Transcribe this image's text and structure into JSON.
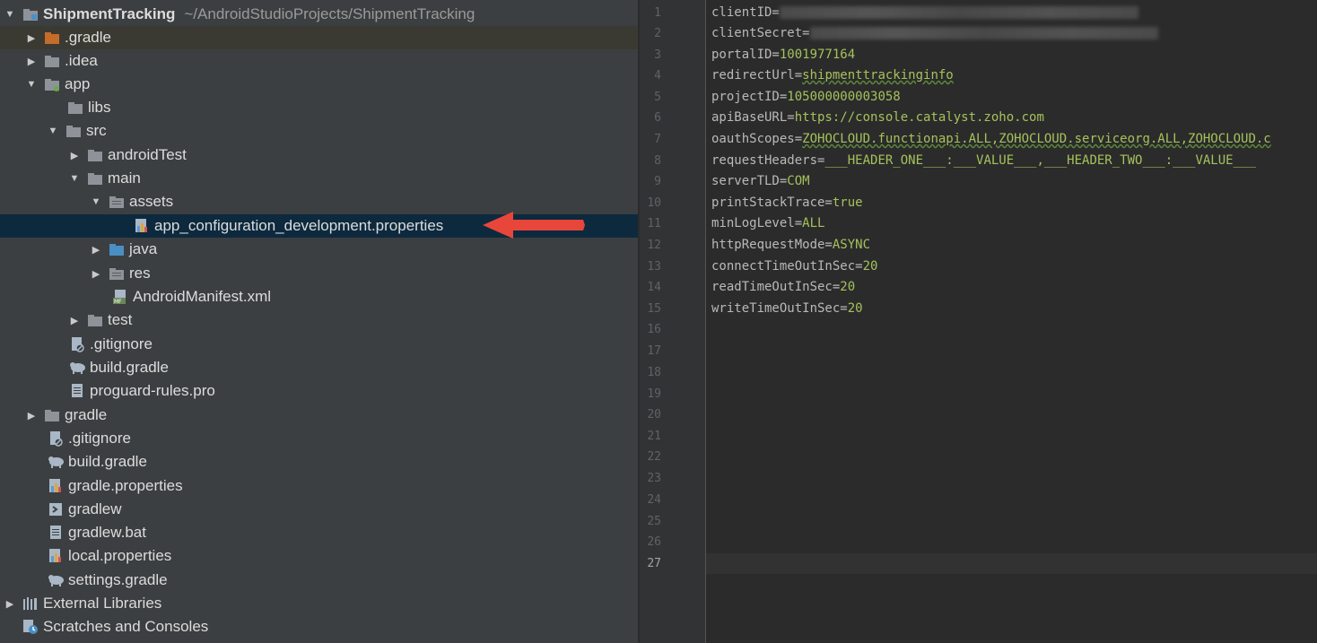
{
  "tree": {
    "project_name": "ShipmentTracking",
    "project_path": "~/AndroidStudioProjects/ShipmentTracking",
    "items": [
      {
        "label": ".gradle"
      },
      {
        "label": ".idea"
      },
      {
        "label": "app"
      },
      {
        "label": "libs"
      },
      {
        "label": "src"
      },
      {
        "label": "androidTest"
      },
      {
        "label": "main"
      },
      {
        "label": "assets"
      },
      {
        "label": "app_configuration_development.properties"
      },
      {
        "label": "java"
      },
      {
        "label": "res"
      },
      {
        "label": "AndroidManifest.xml"
      },
      {
        "label": "test"
      },
      {
        "label": ".gitignore"
      },
      {
        "label": "build.gradle"
      },
      {
        "label": "proguard-rules.pro"
      },
      {
        "label": "gradle"
      },
      {
        "label": ".gitignore"
      },
      {
        "label": "build.gradle"
      },
      {
        "label": "gradle.properties"
      },
      {
        "label": "gradlew"
      },
      {
        "label": "gradlew.bat"
      },
      {
        "label": "local.properties"
      },
      {
        "label": "settings.gradle"
      },
      {
        "label": "External Libraries"
      },
      {
        "label": "Scratches and Consoles"
      }
    ]
  },
  "editor": {
    "line_numbers": [
      "1",
      "2",
      "3",
      "4",
      "5",
      "6",
      "7",
      "8",
      "9",
      "10",
      "11",
      "12",
      "13",
      "14",
      "15",
      "16",
      "17",
      "18",
      "19",
      "20",
      "21",
      "22",
      "23",
      "24",
      "25",
      "26",
      "27"
    ],
    "current_line": "27",
    "lines": [
      {
        "key": "clientID=",
        "value": ""
      },
      {
        "key": "clientSecret=",
        "value": ""
      },
      {
        "key": "portalID=",
        "value": "1001977164"
      },
      {
        "key": "redirectUrl=",
        "value": "shipmenttrackinginfo"
      },
      {
        "key": "projectID=",
        "value": "105000000003058"
      },
      {
        "key": "apiBaseURL=",
        "value": "https://console.catalyst.zoho.com"
      },
      {
        "key": "oauthScopes=",
        "value": "ZOHOCLOUD.functionapi.ALL,ZOHOCLOUD.serviceorg.ALL,ZOHOCLOUD.c"
      },
      {
        "key": "requestHeaders=",
        "value": "___HEADER_ONE___:___VALUE___,___HEADER_TWO___:___VALUE___"
      },
      {
        "key": "serverTLD=",
        "value": "COM"
      },
      {
        "key": "printStackTrace=",
        "value": "true"
      },
      {
        "key": "minLogLevel=",
        "value": "ALL"
      },
      {
        "key": "httpRequestMode=",
        "value": "ASYNC"
      },
      {
        "key": "connectTimeOutInSec=",
        "value": "20"
      },
      {
        "key": "readTimeOutInSec=",
        "value": "20"
      },
      {
        "key": "writeTimeOutInSec=",
        "value": "20"
      }
    ]
  },
  "colors": {
    "panel_bg": "#3c3f41",
    "editor_bg": "#2b2b2b",
    "selection": "#0d293e",
    "accent_arrow": "#e8463b",
    "value_green": "#a5c25c"
  }
}
